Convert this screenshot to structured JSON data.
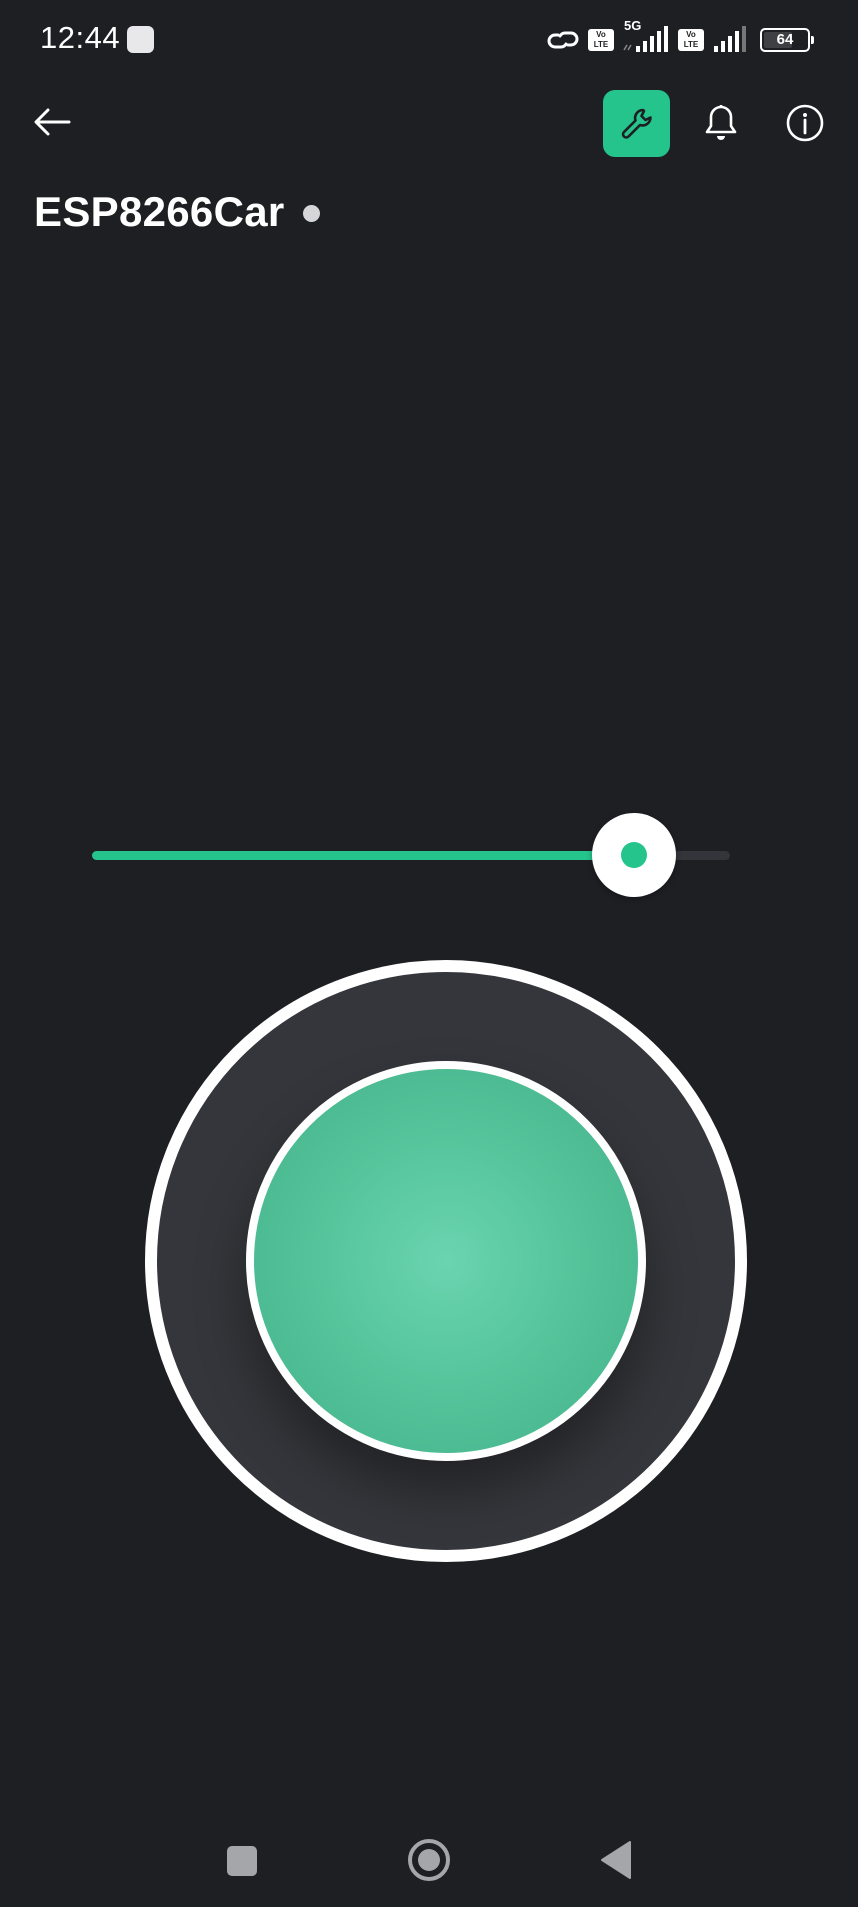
{
  "status_bar": {
    "time": "12:44",
    "network_label": "5G",
    "volte_label": "Vo LTE",
    "battery_level": "64"
  },
  "header": {
    "title": "ESP8266Car"
  },
  "slider": {
    "value_fraction": 0.85
  },
  "joystick": {
    "x": 0,
    "y": 0
  },
  "icons": {
    "back": "back-arrow-icon",
    "wrench": "wrench-icon",
    "bell": "bell-icon",
    "info": "info-icon",
    "link": "link-icon",
    "signal": "signal-icon"
  },
  "colors": {
    "background": "#1e1f23",
    "accent": "#25c48c",
    "joystick_base": "#35363b",
    "joystick_knob": "#56c59c",
    "status_dot": "#d6d6d8"
  }
}
